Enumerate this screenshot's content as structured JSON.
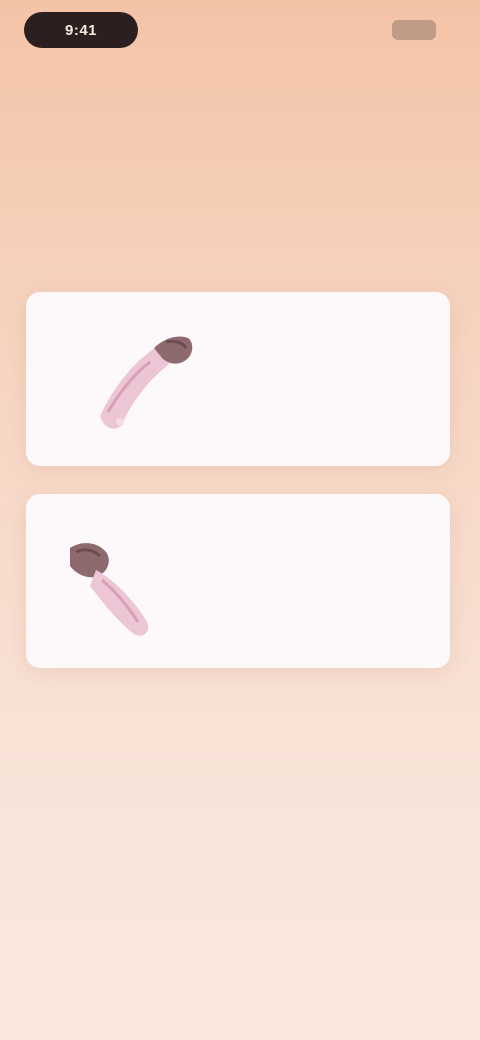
{
  "status_bar": {
    "time": "9:41",
    "battery_icon": "battery-icon"
  },
  "header": {
    "top_link": "",
    "title": "",
    "subtitle": "",
    "subtitle_link": ""
  },
  "cards": [
    {
      "label": "",
      "icon": "hand-icon",
      "accent": "#e3b3c6"
    },
    {
      "label": "",
      "icon": "hand-icon",
      "accent": "#e3b3c6"
    }
  ],
  "colors": {
    "background_top": "#f3c3a6",
    "background_bottom": "#fae8df",
    "card": "#fdf9fa",
    "text_dark": "#3f3a52"
  }
}
